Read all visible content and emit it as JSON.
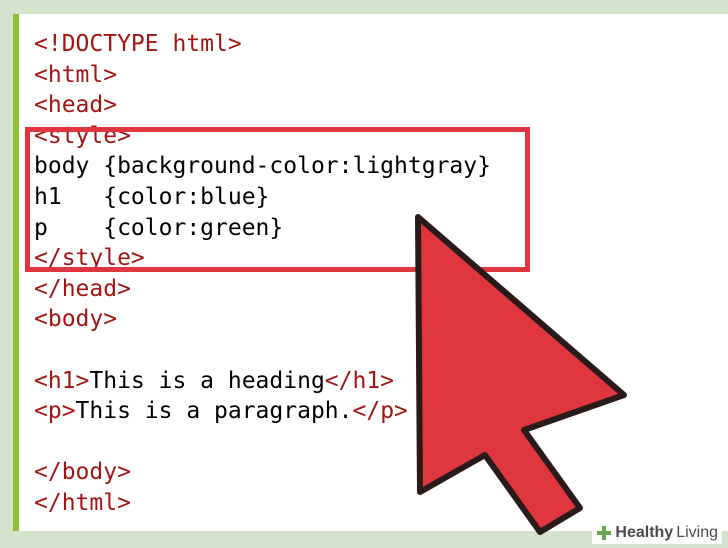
{
  "code_lines": [
    [
      {
        "t": "tag",
        "v": "<!DOCTYPE html>"
      }
    ],
    [
      {
        "t": "tag",
        "v": "<html>"
      }
    ],
    [
      {
        "t": "tag",
        "v": "<head>"
      }
    ],
    [
      {
        "t": "tag",
        "v": "<style>"
      }
    ],
    [
      {
        "t": "txt",
        "v": "body {background-color:lightgray}"
      }
    ],
    [
      {
        "t": "txt",
        "v": "h1   {color:blue}"
      }
    ],
    [
      {
        "t": "txt",
        "v": "p    {color:green}"
      }
    ],
    [
      {
        "t": "tag",
        "v": "</style>"
      }
    ],
    [
      {
        "t": "tag",
        "v": "</head>"
      }
    ],
    [
      {
        "t": "tag",
        "v": "<body>"
      }
    ],
    [
      {
        "t": "txt",
        "v": ""
      }
    ],
    [
      {
        "t": "tag",
        "v": "<h1>"
      },
      {
        "t": "txt",
        "v": "This is a heading"
      },
      {
        "t": "tag",
        "v": "</h1>"
      }
    ],
    [
      {
        "t": "tag",
        "v": "<p>"
      },
      {
        "t": "txt",
        "v": "This is a paragraph."
      },
      {
        "t": "tag",
        "v": "</p>"
      }
    ],
    [
      {
        "t": "txt",
        "v": ""
      }
    ],
    [
      {
        "t": "tag",
        "v": "</body>"
      }
    ],
    [
      {
        "t": "tag",
        "v": "</html>"
      }
    ]
  ],
  "colors": {
    "tag": "#a31515",
    "text": "#000000",
    "highlight": "#e0363f",
    "cursor_fill": "#e0363f",
    "gutter": "#8dbf2f"
  },
  "watermark": {
    "brand_bold": "Healthy",
    "brand_light": "Living"
  }
}
